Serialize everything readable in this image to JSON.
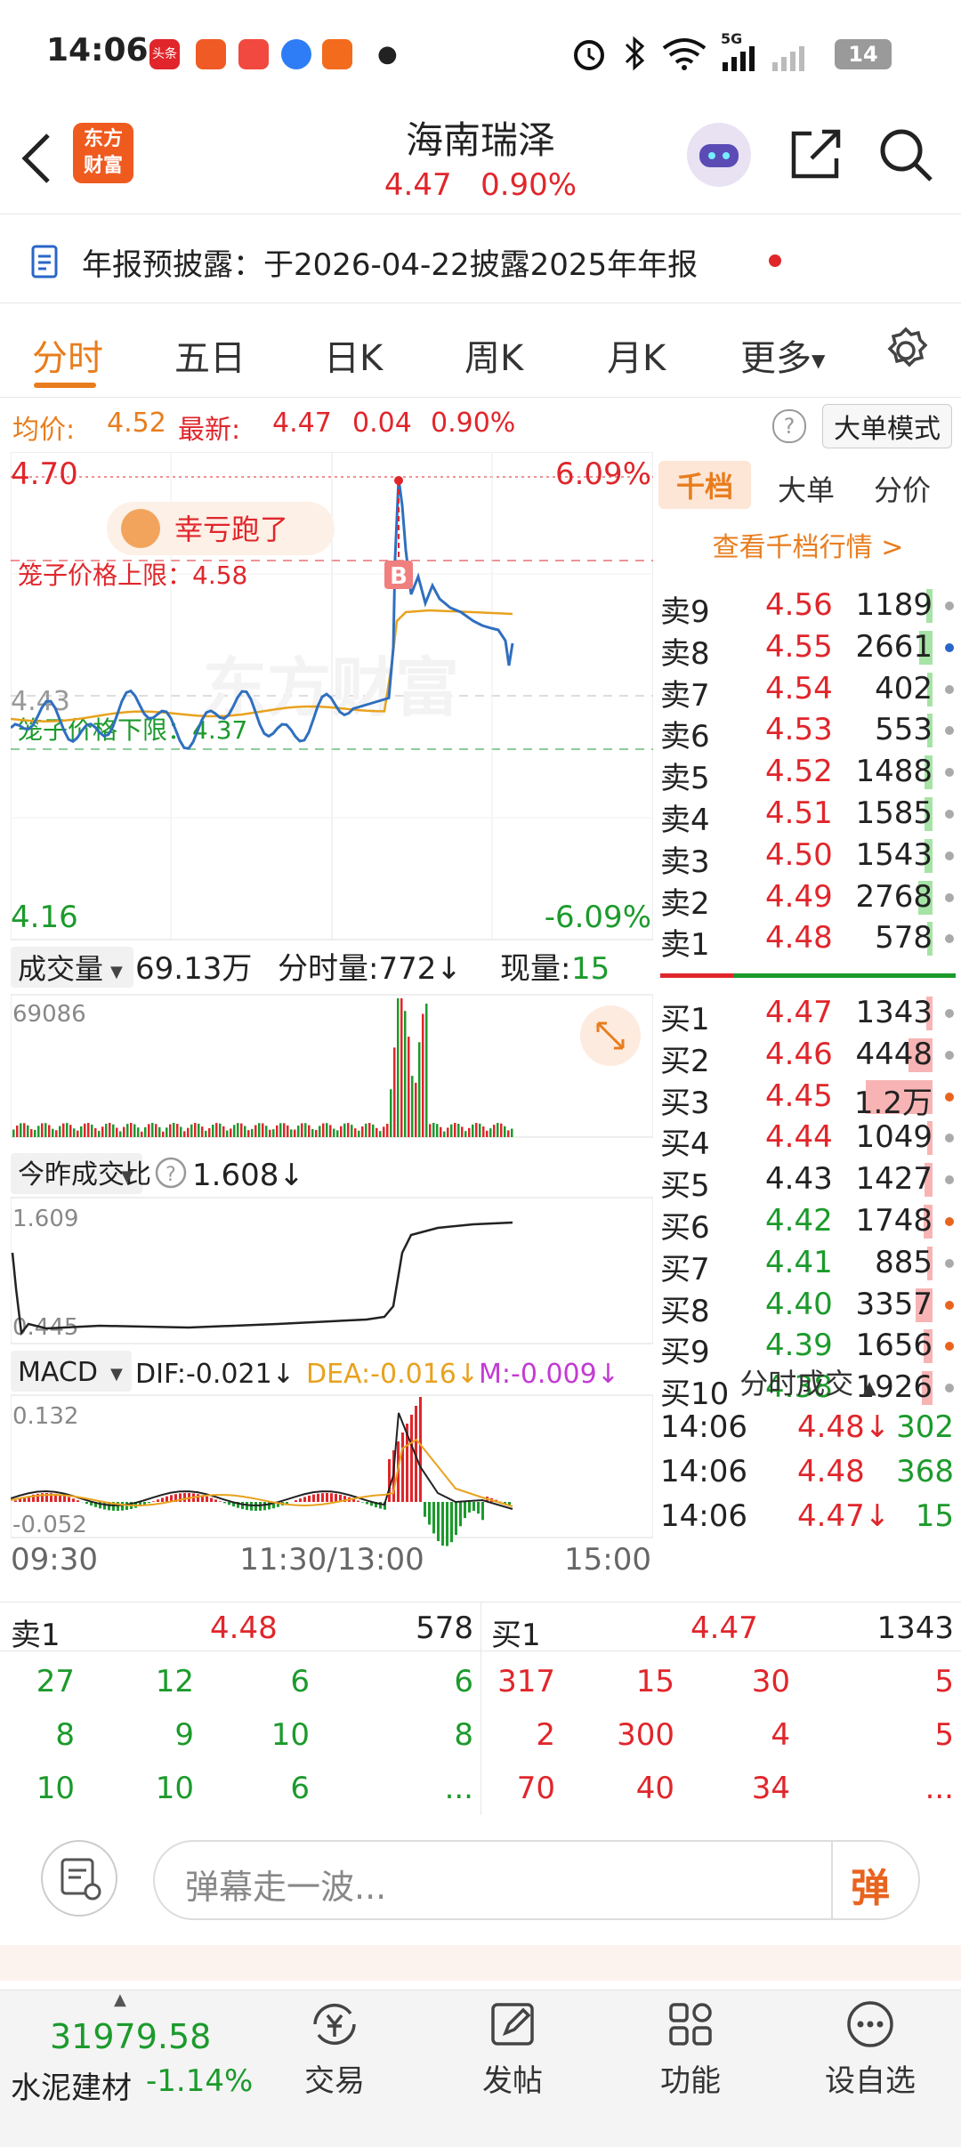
{
  "status_bar": {
    "time": "14:06",
    "app_badge_1": "头条",
    "network": "5G",
    "battery": "14"
  },
  "header": {
    "logo_line1": "东方",
    "logo_line2": "财富",
    "stock_name": "海南瑞泽",
    "price": "4.47",
    "change_pct": "0.90%"
  },
  "notice": {
    "text": "年报预披露：于2026-04-22披露2025年年报"
  },
  "tabs": [
    {
      "label": "分时",
      "active": true
    },
    {
      "label": "五日"
    },
    {
      "label": "日K"
    },
    {
      "label": "周K"
    },
    {
      "label": "月K"
    },
    {
      "label": "更多"
    }
  ],
  "avg_row": {
    "avg_label": "均价:",
    "avg_value": "4.52",
    "latest_label": "最新:",
    "latest_value": "4.47",
    "change": "0.04",
    "change_pct": "0.90%",
    "bigorder_mode": "大单模式"
  },
  "price_chart": {
    "top_price": "4.70",
    "top_pct": "6.09%",
    "bottom_price": "4.16",
    "bottom_pct": "-6.09%",
    "mid_price": "4.43",
    "bubble": "幸亏跑了",
    "cage_upper": "笼子价格上限：4.58",
    "cage_lower": "笼子价格下限：4.37",
    "buy_marker": "B",
    "watermark": "东方财富"
  },
  "volume_panel": {
    "selector": "成交量",
    "total": "69.13万",
    "minute_vol": "分时量:772↓",
    "current_label": "现量:",
    "current_value": "15",
    "max_label": "69086"
  },
  "ratio_panel": {
    "selector": "今昨成交比",
    "value": "1.608↓",
    "max": "1.609",
    "min": "0.445"
  },
  "macd_panel": {
    "selector": "MACD",
    "dif": "DIF:-0.021↓",
    "dea": "DEA:-0.016↓",
    "m": "M:-0.009↓",
    "max": "0.132",
    "min": "-0.052"
  },
  "time_axis": {
    "start": "09:30",
    "mid": "11:30/13:00",
    "end": "15:00"
  },
  "order_book": {
    "tabs": [
      "千档",
      "大单",
      "分价"
    ],
    "link": "查看千档行情 >",
    "sell": [
      {
        "label": "卖9",
        "price": "4.56",
        "vol": "1189",
        "pct": 0.05,
        "price_color": "red",
        "dot": "gray"
      },
      {
        "label": "卖8",
        "price": "4.55",
        "vol": "2661",
        "pct": 0.1,
        "price_color": "red",
        "dot": "blue"
      },
      {
        "label": "卖7",
        "price": "4.54",
        "vol": "402",
        "pct": 0.02,
        "price_color": "red",
        "dot": "gray"
      },
      {
        "label": "卖6",
        "price": "4.53",
        "vol": "553",
        "pct": 0.02,
        "price_color": "red",
        "dot": "gray"
      },
      {
        "label": "卖5",
        "price": "4.52",
        "vol": "1488",
        "pct": 0.06,
        "price_color": "red",
        "dot": "gray"
      },
      {
        "label": "卖4",
        "price": "4.51",
        "vol": "1585",
        "pct": 0.06,
        "price_color": "red",
        "dot": "gray"
      },
      {
        "label": "卖3",
        "price": "4.50",
        "vol": "1543",
        "pct": 0.06,
        "price_color": "red",
        "dot": "gray"
      },
      {
        "label": "卖2",
        "price": "4.49",
        "vol": "2768",
        "pct": 0.11,
        "price_color": "red",
        "dot": "gray"
      },
      {
        "label": "卖1",
        "price": "4.48",
        "vol": "578",
        "pct": 0.02,
        "price_color": "red",
        "dot": "gray"
      }
    ],
    "buy": [
      {
        "label": "买1",
        "price": "4.47",
        "vol": "1343",
        "pct": 0.05,
        "price_color": "red",
        "dot": "gray"
      },
      {
        "label": "买2",
        "price": "4.46",
        "vol": "4448",
        "pct": 0.18,
        "price_color": "red",
        "dot": "gray"
      },
      {
        "label": "买3",
        "price": "4.45",
        "vol": "1.2万",
        "pct": 0.5,
        "price_color": "red",
        "dot": "orange"
      },
      {
        "label": "买4",
        "price": "4.44",
        "vol": "1049",
        "pct": 0.04,
        "price_color": "red",
        "dot": "gray"
      },
      {
        "label": "买5",
        "price": "4.43",
        "vol": "1427",
        "pct": 0.06,
        "price_color": "black",
        "dot": "gray"
      },
      {
        "label": "买6",
        "price": "4.42",
        "vol": "1748",
        "pct": 0.07,
        "price_color": "green",
        "dot": "orange"
      },
      {
        "label": "买7",
        "price": "4.41",
        "vol": "885",
        "pct": 0.04,
        "price_color": "green",
        "dot": "gray"
      },
      {
        "label": "买8",
        "price": "4.40",
        "vol": "3357",
        "pct": 0.13,
        "price_color": "green",
        "dot": "orange"
      },
      {
        "label": "买9",
        "price": "4.39",
        "vol": "1656",
        "pct": 0.07,
        "price_color": "green",
        "dot": "orange"
      },
      {
        "label": "买10",
        "price": "4.38",
        "vol": "1926",
        "pct": 0.08,
        "price_color": "green",
        "dot": "gray"
      }
    ],
    "trades_title": "分时成交",
    "trades": [
      {
        "time": "14:06",
        "price": "4.48↓",
        "vol": "302"
      },
      {
        "time": "14:06",
        "price": "4.48",
        "vol": "368"
      },
      {
        "time": "14:06",
        "price": "4.47↓",
        "vol": "15"
      }
    ]
  },
  "quotes": {
    "sell_label": "卖1",
    "sell_price": "4.48",
    "sell_vol": "578",
    "buy_label": "买1",
    "buy_price": "4.47",
    "buy_vol": "1343",
    "sell_rows": [
      [
        "27",
        "12",
        "6",
        "6"
      ],
      [
        "8",
        "9",
        "10",
        "8"
      ],
      [
        "10",
        "10",
        "6",
        "..."
      ]
    ],
    "buy_rows": [
      [
        "317",
        "15",
        "30",
        "5"
      ],
      [
        "2",
        "300",
        "4",
        "5"
      ],
      [
        "70",
        "40",
        "34",
        "..."
      ]
    ]
  },
  "danmaku": {
    "placeholder": "弹幕走一波...",
    "send": "弹"
  },
  "bottom_nav": {
    "index_value": "31979.58",
    "index_name": "水泥建材",
    "index_change": "-1.14%",
    "items": [
      "交易",
      "发帖",
      "功能",
      "设自选"
    ]
  },
  "colors": {
    "up": "#e0262b",
    "down": "#1c9a2c",
    "accent": "#e87d1e"
  }
}
